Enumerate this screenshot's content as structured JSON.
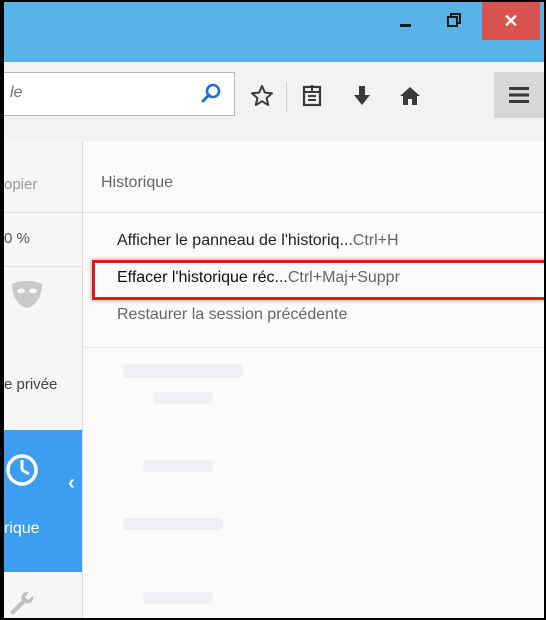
{
  "window": {
    "minimize_icon": "minimize-icon",
    "restore_icon": "restore-icon",
    "close_glyph": "✕",
    "accent_color": "#59b3e9",
    "close_color": "#d9534f"
  },
  "toolbar": {
    "url_text": "le",
    "icons": [
      "search-icon",
      "star-icon",
      "reader-list-icon",
      "download-arrow-icon",
      "home-icon",
      "hamburger-menu-icon"
    ]
  },
  "left_panel": {
    "copy_label": "opier",
    "zoom_value": "0 %",
    "private_label": "e privée",
    "history_label": "rique",
    "back_glyph": "‹",
    "active_color": "#3d9ef0"
  },
  "history_panel": {
    "title": "Historique",
    "items": [
      {
        "label": "Afficher le panneau de l'historiq...",
        "shortcut": "Ctrl+H"
      },
      {
        "label": "Effacer l'historique réc...",
        "shortcut": "Ctrl+Maj+Suppr"
      },
      {
        "label": "Restaurer la session précédente",
        "shortcut": ""
      }
    ],
    "highlight_color": "#d0201f"
  }
}
